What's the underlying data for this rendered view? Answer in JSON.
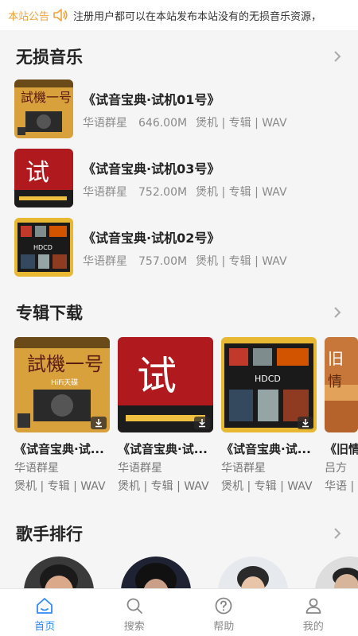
{
  "notice": {
    "label": "本站公告",
    "text": "注册用户都可以在本站发布本站没有的无损音乐资源，"
  },
  "lossless": {
    "title": "无损音乐",
    "items": [
      {
        "title": "《试音宝典·试机01号》",
        "artist": "华语群星",
        "size": "646.00M",
        "tags": "煲机 | 专辑 | WAV"
      },
      {
        "title": "《试音宝典·试机03号》",
        "artist": "华语群星",
        "size": "752.00M",
        "tags": "煲机 | 专辑 | WAV"
      },
      {
        "title": "《试音宝典·试机02号》",
        "artist": "华语群星",
        "size": "757.00M",
        "tags": "煲机 | 专辑 | WAV"
      }
    ]
  },
  "albums": {
    "title": "专辑下载",
    "items": [
      {
        "title": "《试音宝典·试...",
        "artist": "华语群星",
        "tags": "煲机 | 专辑 | WAV"
      },
      {
        "title": "《试音宝典·试...",
        "artist": "华语群星",
        "tags": "煲机 | 专辑 | WAV"
      },
      {
        "title": "《试音宝典·试...",
        "artist": "华语群星",
        "tags": "煲机 | 专辑 | WAV"
      },
      {
        "title": "《旧情",
        "artist": "吕方",
        "tags": "华语 |"
      }
    ]
  },
  "singers": {
    "title": "歌手排行"
  },
  "tabbar": {
    "home": "首页",
    "search": "搜索",
    "help": "帮助",
    "mine": "我的"
  },
  "colors": {
    "accent": "#2f8bf5",
    "notice": "#f2a23a"
  }
}
